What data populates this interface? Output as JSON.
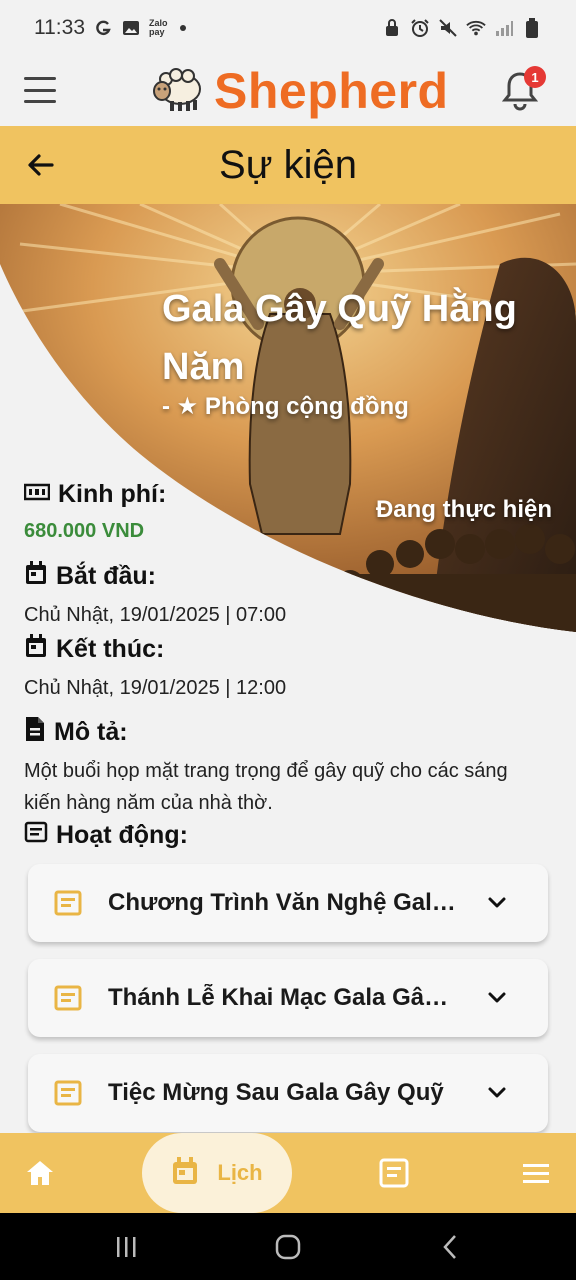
{
  "status_bar": {
    "time": "11:33",
    "zalo_line1": "Zalo",
    "zalo_line2": "pay"
  },
  "header": {
    "brand": "Shepherd",
    "notification_count": "1"
  },
  "title_bar": {
    "title": "Sự kiện"
  },
  "event": {
    "title": "Gala Gây Quỹ Hằng Năm",
    "subtitle": "- ★ Phòng cộng đồng",
    "status": "Đang thực hiện"
  },
  "info": {
    "budget_label": "Kinh phí:",
    "budget_value": "680.000 VND",
    "start_label": "Bắt đầu:",
    "start_value": "Chủ Nhật, 19/01/2025 | 07:00",
    "end_label": "Kết thúc:",
    "end_value": "Chủ Nhật, 19/01/2025 | 12:00",
    "desc_label": "Mô tả:",
    "desc_value": "Một buổi họp mặt trang trọng để gây quỹ cho các sáng kiến hàng năm của nhà thờ.",
    "activities_label": "Hoạt động:"
  },
  "activities": [
    "Chương Trình Văn Nghệ Gala Gây Quỹ",
    "Thánh Lễ Khai Mạc Gala Gây Quỹ",
    "Tiệc Mừng Sau Gala Gây Quỹ"
  ],
  "bottom_nav": {
    "calendar_label": "Lịch"
  },
  "colors": {
    "brand": "#ee6c23",
    "accent": "#f0c360",
    "budget": "#3b8c3b",
    "badge": "#e53935"
  }
}
